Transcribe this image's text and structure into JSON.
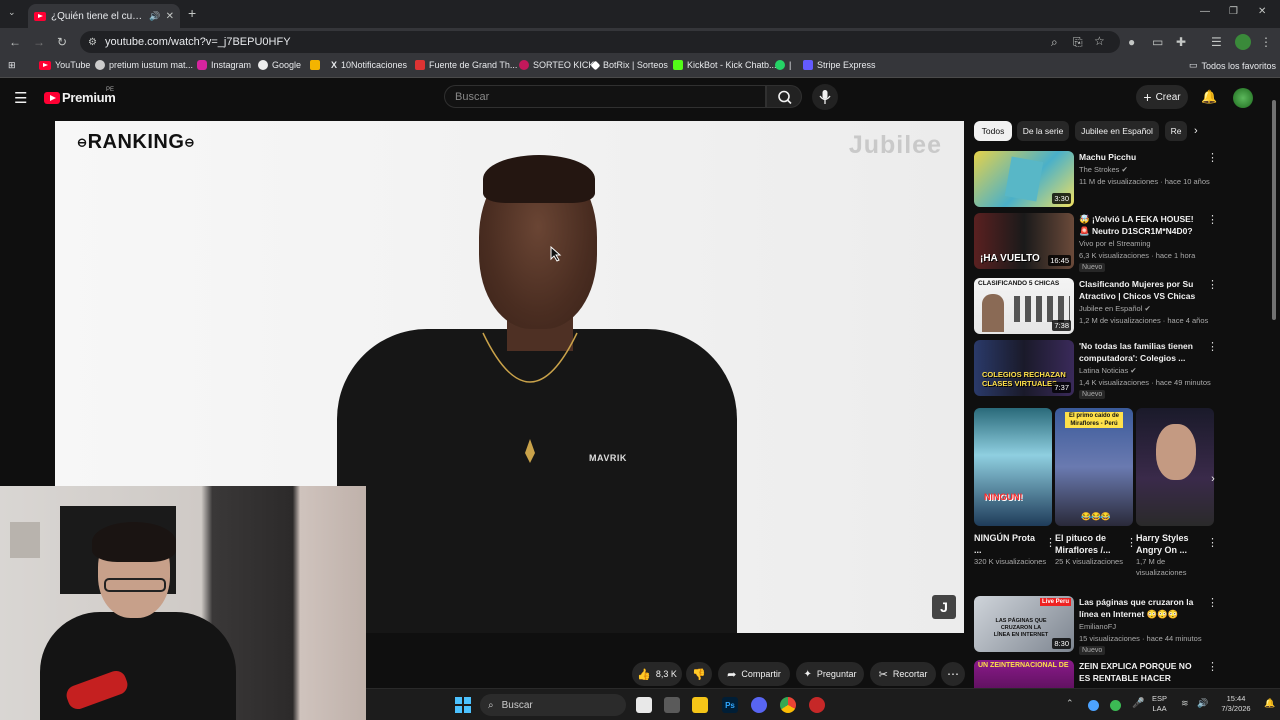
{
  "browser": {
    "tab_title": "¿Quién tiene el cuerpo más",
    "url": "youtube.com/watch?v=_j7BEPU0HFY",
    "bookmarks": [
      "YouTube",
      "pretium iustum mat...",
      "Instagram",
      "Google",
      "10Notificaciones",
      "Fuente de Grand Th...",
      "SORTEO KICK",
      "BotRix | Sorteos",
      "KickBot - Kick Chatb...",
      "|",
      "Stripe Express"
    ],
    "all_bookmarks": "Todos los favoritos"
  },
  "youtube": {
    "logo": "Premium",
    "logo_region": "PE",
    "search_placeholder": "Buscar",
    "create_label": "Crear"
  },
  "video": {
    "overlay_ranking": "RANKING",
    "watermark": "Jubilee",
    "shirt_text": "MAVRIK",
    "badge": "J"
  },
  "actions": {
    "likes": "8,3 K",
    "share": "Compartir",
    "ask": "Preguntar",
    "clip": "Recortar"
  },
  "chips": [
    "Todos",
    "De la serie",
    "Jubilee en Español",
    "Re"
  ],
  "recommendations": [
    {
      "title": "Machu Picchu",
      "channel": "The Strokes",
      "meta": "11 M de visualizaciones · hace 10 años",
      "duration": "3:30",
      "badge": ""
    },
    {
      "title": "🤯 ¡Volvió LA FEKA HOUSE! 🚨 Neutro D1SCR1M*N4D0? 😡 | ...",
      "channel": "Vivo por el Streaming",
      "meta": "6,3 K visualizaciones · hace 1 hora",
      "duration": "16:45",
      "badge": "Nuevo"
    },
    {
      "title": "Clasificando Mujeres por Su Atractivo | Chicos VS Chicas",
      "channel": "Jubilee en Español",
      "meta": "1,2 M de visualizaciones · hace 4 años",
      "duration": "7:38",
      "badge": ""
    },
    {
      "title": "'No todas las familias tienen computadora': Colegios ...",
      "channel": "Latina Noticias",
      "meta": "1,4 K visualizaciones · hace 49 minutos",
      "duration": "7:37",
      "badge": "Nuevo"
    },
    {
      "title": "Las páginas que cruzaron la línea en Internet 😳😳😳",
      "channel": "EmilianoFJ",
      "meta": "15 visualizaciones · hace 44 minutos",
      "duration": "8:30",
      "badge": "Nuevo"
    },
    {
      "title": "ZEIN EXPLICA PORQUE NO ES RENTABLE HACER TORNEOS ...",
      "channel": "",
      "meta": "",
      "duration": "",
      "badge": ""
    }
  ],
  "thumb_texts": {
    "rec2": "¡HA VUELTO",
    "rec3": "CLASIFICANDO 5 CHICAS",
    "rec4": "COLEGIOS RECHAZAN CLASES VIRTUALES",
    "rec5": "LAS PÁGINAS QUE CRUZARON LA LÍNEA EN INTERNET",
    "rec6": "UN ZEINTERNACIONAL DE",
    "short1": "NINGUN!",
    "short2": "El primo caído de Miraflores - Perú",
    "short2b": "😂😂😂",
    "live": "Live Peru"
  },
  "shorts": [
    {
      "title": "NINGÚN Prota ...",
      "views": "320 K visualizaciones"
    },
    {
      "title": "El pituco de Miraflores /...",
      "views": "25 K visualizaciones"
    },
    {
      "title": "Harry Styles Angry On ...",
      "views": "1,7 M de visualizaciones"
    }
  ],
  "taskbar": {
    "search": "Buscar",
    "lang": "ESP",
    "lang2": "LAA",
    "time": "15:44",
    "date": "7/3/2026"
  },
  "colors": {
    "yt_red": "#ff0033",
    "bg": "#0f0f0f",
    "chip_bg": "#272727"
  }
}
